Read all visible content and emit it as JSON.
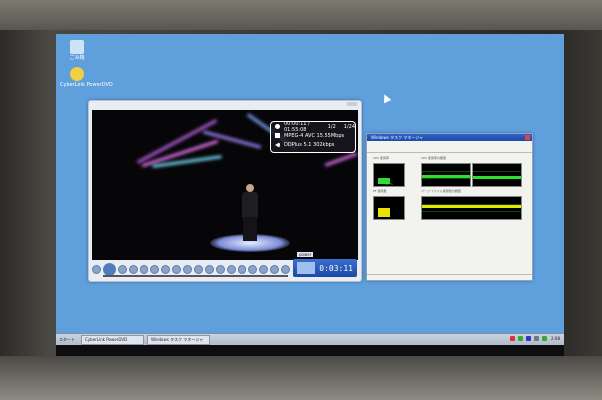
{
  "desktop": {
    "icons": [
      {
        "label": "ごみ箱",
        "icon": "recycle-bin-icon",
        "color": "#cfe3f7"
      },
      {
        "label": "CyberLink PowerDVD",
        "icon": "powerdvd-icon",
        "color": "#f0d040"
      }
    ]
  },
  "player": {
    "title": "",
    "osd": {
      "time": "00:00:11 / 01:55:08",
      "chapter": "1/2",
      "title_num": "1/24",
      "video": "MPEG-4 AVC  15.55Mbps",
      "audio": "DDPlus 5.1  302kbps"
    },
    "logo": "power",
    "time": "0:03:11"
  },
  "taskmgr": {
    "title": "Windows タスク マネージャ",
    "cpu_label": "CPU 使用率",
    "cpu_value": "32 %",
    "cpu_usage": 0.32,
    "cpu_history_label": "CPU 使用率の履歴",
    "pf_label": "PF 使用量",
    "pf_usage": 0.5,
    "pf_history_label": "ページ ファイル使用量の履歴"
  },
  "taskbar": {
    "start": "スタート",
    "items": [
      "CyberLink PowerDVD",
      "Windows タスク マネージャ"
    ],
    "clock": "2:08"
  }
}
